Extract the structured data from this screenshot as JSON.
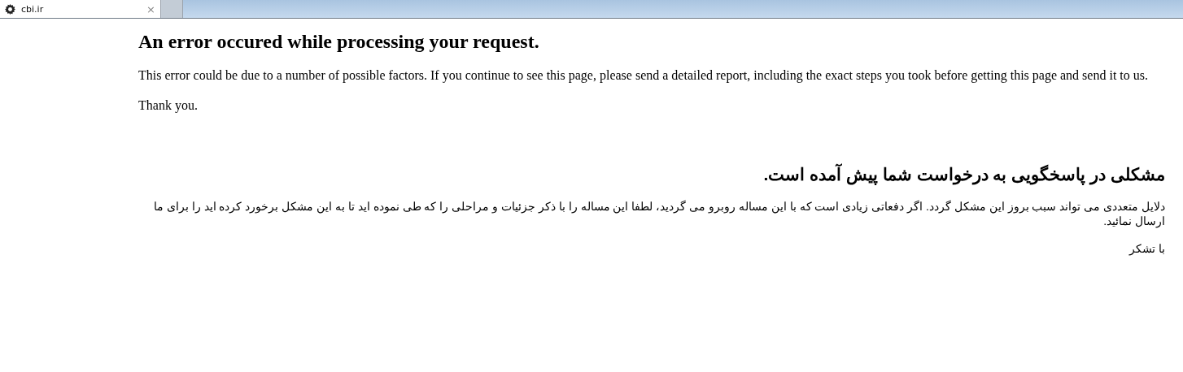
{
  "tabs": [
    {
      "label": "cbi.ir",
      "close": "×",
      "selected": true
    }
  ],
  "english": {
    "heading": "An error occured while processing your request.",
    "paragraphs": [
      "This error could be due to a number of possible factors. If you continue to see this page, please send a detailed report, including the exact steps you took before getting this page and send it to us.",
      "Thank you."
    ]
  },
  "persian": {
    "heading": "مشکلی در پاسخگویی به درخواست شما پیش آمده است.",
    "paragraphs": [
      "دلایل متعددی می تواند سبب بروز این مشکل گردد. اگر دفعاتی زیادی است که با این مساله روبرو می گردید، لطفا این مساله را با ذکر جزئیات و مراحلی را که طی نموده اید تا به این مشکل برخورد کرده اید را برای ما ارسال نمائید.",
      "با تشکر"
    ]
  }
}
